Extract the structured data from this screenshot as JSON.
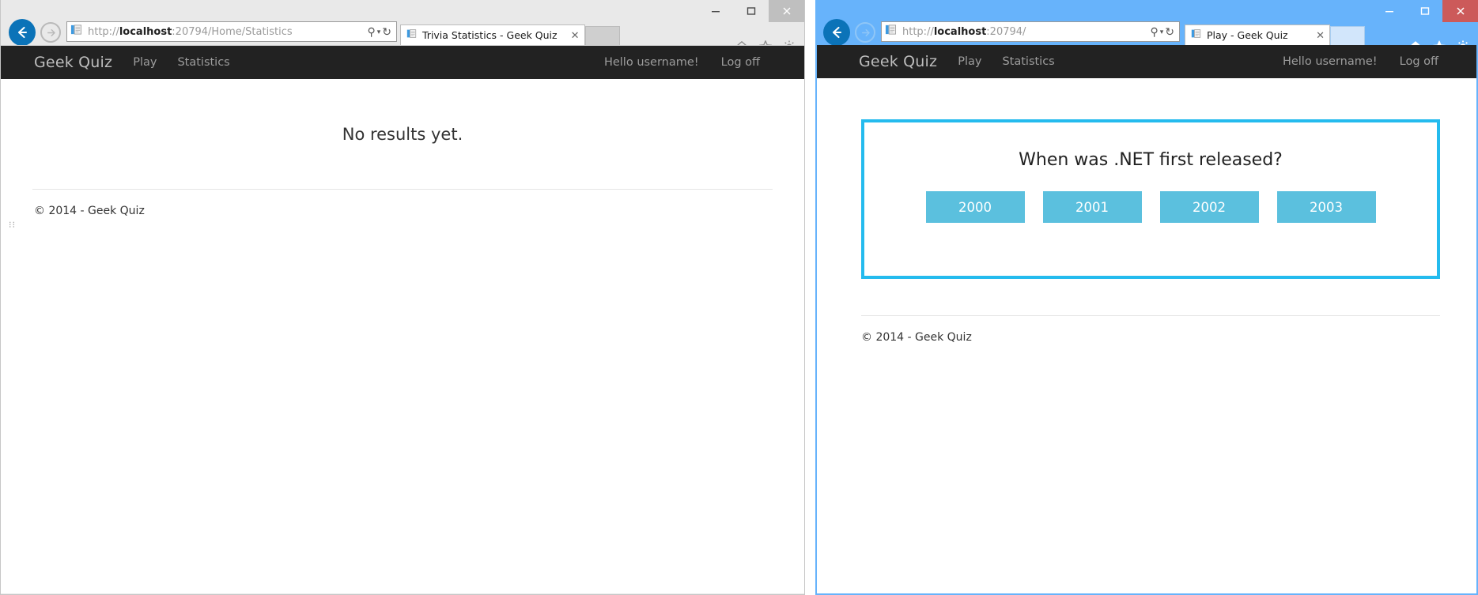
{
  "windows": {
    "left": {
      "name": "trivia-statistics-window",
      "state": "inactive",
      "address": {
        "protocol": "http://",
        "host": "localhost",
        "rest": ":20794/Home/Statistics",
        "full": "http://localhost:20794/Home/Statistics"
      },
      "tab": {
        "title": "Trivia Statistics - Geek Quiz",
        "close_label": "✕"
      },
      "window_controls": {
        "minimize": "–",
        "maximize": "❑",
        "close": "✕"
      },
      "command_icons": [
        "home-icon",
        "favorites-star-icon",
        "settings-gear-icon"
      ],
      "address_tools": {
        "search": "⚲",
        "dropdown": "▾",
        "refresh": "↻"
      },
      "page": {
        "navbar": {
          "brand": "Geek Quiz",
          "links": [
            "Play",
            "Statistics"
          ],
          "greeting": "Hello username!",
          "logoff": "Log off"
        },
        "content": {
          "message": "No results yet."
        },
        "footer": {
          "copyright": "© 2014 - Geek Quiz"
        }
      }
    },
    "right": {
      "name": "play-geek-quiz-window",
      "state": "active",
      "address": {
        "protocol": "http://",
        "host": "localhost",
        "rest": ":20794/",
        "full": "http://localhost:20794/"
      },
      "tab": {
        "title": "Play - Geek Quiz",
        "close_label": "✕"
      },
      "window_controls": {
        "minimize": "–",
        "maximize": "❑",
        "close": "✕"
      },
      "command_icons": [
        "home-icon",
        "favorites-star-icon",
        "settings-gear-icon"
      ],
      "address_tools": {
        "search": "⚲",
        "dropdown": "▾",
        "refresh": "↻"
      },
      "page": {
        "navbar": {
          "brand": "Geek Quiz",
          "links": [
            "Play",
            "Statistics"
          ],
          "greeting": "Hello username!",
          "logoff": "Log off"
        },
        "quiz": {
          "question": "When was .NET first released?",
          "answers": [
            "2000",
            "2001",
            "2002",
            "2003"
          ]
        },
        "footer": {
          "copyright": "© 2014 - Geek Quiz"
        }
      }
    }
  },
  "colors": {
    "navbar_bg": "#222222",
    "quiz_border": "#24bbee",
    "answer_btn": "#5bc0de",
    "active_window_chrome": "#67b3fb",
    "inactive_window_chrome": "#e9e9e9",
    "close_active": "#cc5a5a",
    "back_button": "#0b73b8"
  }
}
